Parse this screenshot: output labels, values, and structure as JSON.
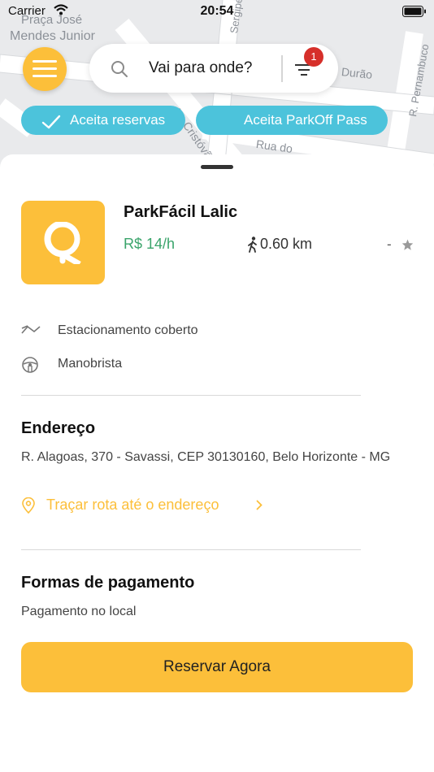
{
  "status_bar": {
    "carrier": "Carrier",
    "time": "20:54"
  },
  "map": {
    "labels": [
      "Praça José",
      "Mendes Junior",
      "Sergipe",
      "Durão",
      "Av. Cristóvã",
      "Rua do",
      "R. Pernambuco"
    ]
  },
  "search": {
    "placeholder": "Vai para onde?",
    "filter_count": "1"
  },
  "chips": [
    "Aceita reservas",
    "Aceita ParkOff Pass"
  ],
  "parking": {
    "name": "ParkFácil Lalic",
    "price": "R$ 14/h",
    "distance": "0.60 km",
    "rating": "-"
  },
  "features": [
    "Estacionamento coberto",
    "Manobrista"
  ],
  "address_section": {
    "title": "Endereço",
    "address": "R. Alagoas, 370 - Savassi, CEP 30130160, Belo Horizonte - MG",
    "route_label": "Traçar rota até o endereço"
  },
  "payment_section": {
    "title": "Formas de pagamento",
    "method": "Pagamento no local"
  },
  "cta": {
    "label": "Reservar Agora"
  },
  "colors": {
    "brand_yellow": "#fcbf3a",
    "chip_blue": "#4cc3db",
    "price_green": "#3aa46b",
    "badge_red": "#d62f2a"
  }
}
